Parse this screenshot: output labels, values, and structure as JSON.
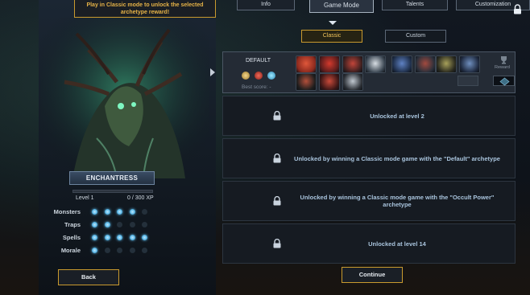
{
  "hint": "Play in Classic mode to unlock the selected archetype reward!",
  "character": {
    "name": "ENCHANTRESS",
    "level_text": "Level 1",
    "xp_text": "0 / 300 XP",
    "xp_fraction": 0.0
  },
  "stats": [
    {
      "label": "Monsters",
      "filled": 4,
      "total": 5
    },
    {
      "label": "Traps",
      "filled": 2,
      "total": 5
    },
    {
      "label": "Spells",
      "filled": 5,
      "total": 5
    },
    {
      "label": "Morale",
      "filled": 1,
      "total": 5
    }
  ],
  "buttons": {
    "back": "Back",
    "continue": "Continue"
  },
  "tabs": [
    {
      "label": "Info",
      "active": false
    },
    {
      "label": "Game Mode",
      "active": true
    },
    {
      "label": "Talents",
      "active": false
    },
    {
      "label": "Customization",
      "active": false
    }
  ],
  "subtabs": [
    {
      "label": "Classic",
      "active": true
    },
    {
      "label": "Custom",
      "active": false
    }
  ],
  "archetype": {
    "title": "DEFAULT",
    "best_score": "Best score: -",
    "reward_label": "Reward"
  },
  "locked_cards": [
    {
      "text": "Unlocked at level 2"
    },
    {
      "text": "Unlocked by winning a Classic mode game with the \"Default\" archetype"
    },
    {
      "text": "Unlocked by winning a Classic mode game with the \"Occult Power\" archetype"
    },
    {
      "text": "Unlocked at level 14"
    }
  ],
  "colors": {
    "accent_gold": "#c99a2e",
    "dot_on": "#55b4e6",
    "locked_text": "#a9c4dd"
  },
  "icons": [
    "lock-icon",
    "trophy-icon",
    "diamond-icon",
    "skull-icon",
    "demon-icon",
    "gem-icon"
  ]
}
